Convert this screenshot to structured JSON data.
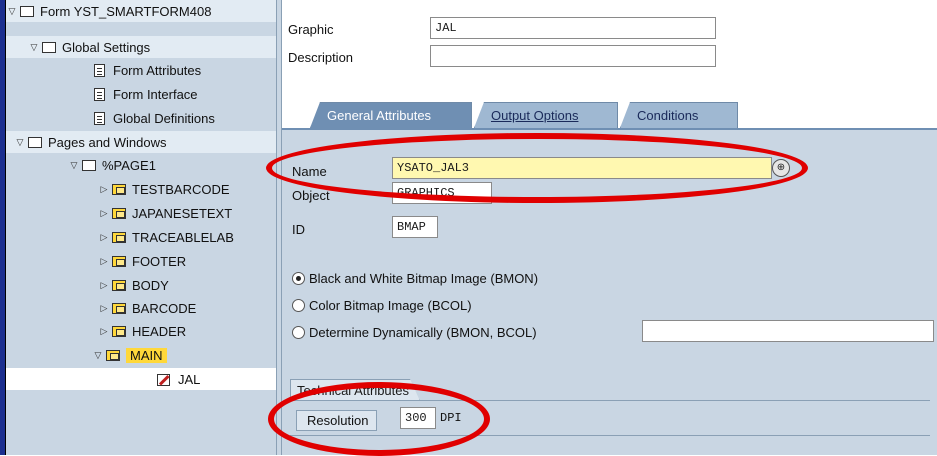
{
  "tree": {
    "root": "Form YST_SMARTFORM408",
    "global_settings": "Global Settings",
    "form_attributes": "Form Attributes",
    "form_interface": "Form Interface",
    "global_definitions": "Global Definitions",
    "pages_and_windows": "Pages and Windows",
    "page1": "%PAGE1",
    "windows": [
      "TESTBARCODE",
      "JAPANESETEXT",
      "TRACEABLELAB",
      "FOOTER",
      "BODY",
      "BARCODE",
      "HEADER"
    ],
    "main": "MAIN",
    "graphic_node": "JAL"
  },
  "header": {
    "graphic_label": "Graphic",
    "graphic_value": "JAL",
    "description_label": "Description",
    "description_value": ""
  },
  "tabs": {
    "general": "General Attributes",
    "output": "Output Options",
    "conditions": "Conditions"
  },
  "general": {
    "name_label": "Name",
    "name_value": "YSATO_JAL3",
    "object_label": "Object",
    "object_value": "GRAPHICS",
    "id_label": "ID",
    "id_value": "BMAP"
  },
  "radios": {
    "bmon": "Black and White Bitmap Image (BMON)",
    "bcol": "Color Bitmap Image (BCOL)",
    "dynamic": "Determine Dynamically (BMON, BCOL)",
    "selected": "bmon"
  },
  "technical": {
    "group_title": "Technical Attributes",
    "resolution_label": "Resolution",
    "resolution_value": "300",
    "unit": "DPI"
  },
  "colors": {
    "annotation": "#e00000",
    "tree_bg": "#c9d6e3",
    "active_tab": "#6f8fb3",
    "highlight_input": "#fff8b0"
  }
}
